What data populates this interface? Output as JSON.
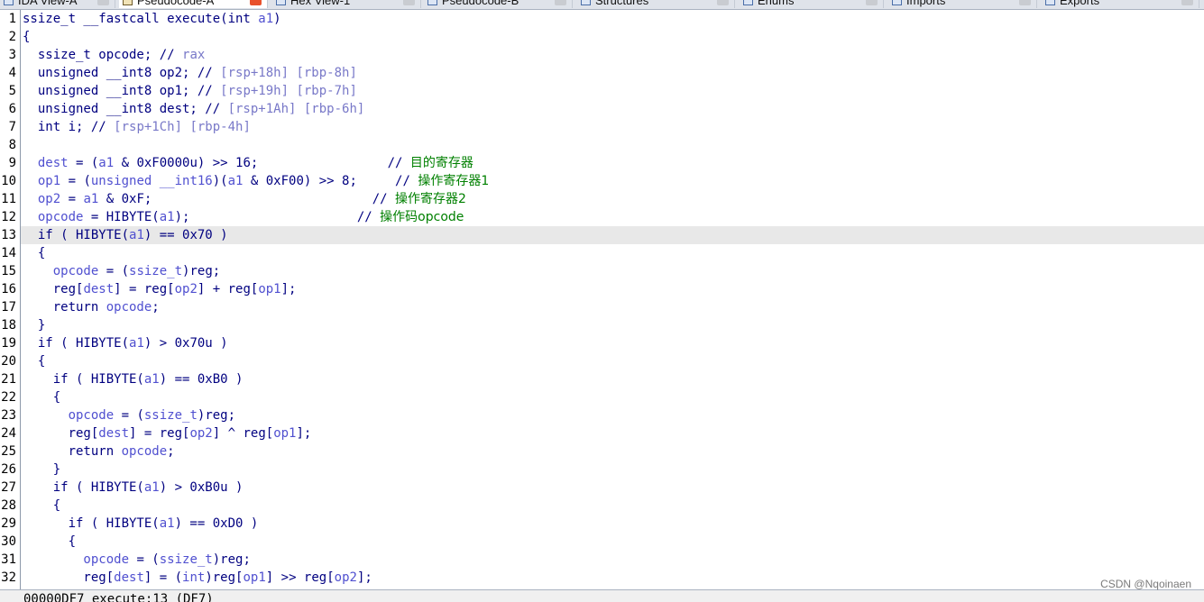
{
  "tabs": [
    {
      "label": "IDA View-A",
      "active": false
    },
    {
      "label": "Pseudocode-A",
      "active": true
    },
    {
      "label": "Hex View-1",
      "active": false
    },
    {
      "label": "Pseudocode-B",
      "active": false
    },
    {
      "label": "Structures",
      "active": false
    },
    {
      "label": "Enums",
      "active": false
    },
    {
      "label": "Imports",
      "active": false
    },
    {
      "label": "Exports",
      "active": false
    }
  ],
  "current_line": 13,
  "code_lines": [
    {
      "n": "1",
      "segs": [
        [
          "t-def",
          "ssize_t __fastcall execute(int "
        ],
        [
          "t-var",
          "a1"
        ],
        [
          "t-def",
          ")"
        ]
      ]
    },
    {
      "n": "2",
      "segs": [
        [
          "t-def",
          "{"
        ]
      ]
    },
    {
      "n": "3",
      "segs": [
        [
          "t-def",
          "  ssize_t opcode; // "
        ],
        [
          "t-cmt",
          "rax"
        ]
      ]
    },
    {
      "n": "4",
      "segs": [
        [
          "t-def",
          "  unsigned __int8 op2; // "
        ],
        [
          "t-cmt",
          "[rsp+18h] [rbp-8h]"
        ]
      ]
    },
    {
      "n": "5",
      "segs": [
        [
          "t-def",
          "  unsigned __int8 op1; // "
        ],
        [
          "t-cmt",
          "[rsp+19h] [rbp-7h]"
        ]
      ]
    },
    {
      "n": "6",
      "segs": [
        [
          "t-def",
          "  unsigned __int8 dest; // "
        ],
        [
          "t-cmt",
          "[rsp+1Ah] [rbp-6h]"
        ]
      ]
    },
    {
      "n": "7",
      "segs": [
        [
          "t-def",
          "  int i; // "
        ],
        [
          "t-cmt",
          "[rsp+1Ch] [rbp-4h]"
        ]
      ]
    },
    {
      "n": "8",
      "segs": []
    },
    {
      "n": "9",
      "segs": [
        [
          "t-var",
          "  dest"
        ],
        [
          "t-def",
          " = ("
        ],
        [
          "t-var",
          "a1"
        ],
        [
          "t-def",
          " & 0xF0000u) >> 16;                 // "
        ],
        [
          "t-cn",
          "目的寄存器"
        ]
      ]
    },
    {
      "n": "10",
      "segs": [
        [
          "t-var",
          "  op1"
        ],
        [
          "t-def",
          " = ("
        ],
        [
          "t-var",
          "unsigned __int16"
        ],
        [
          "t-def",
          ")("
        ],
        [
          "t-var",
          "a1"
        ],
        [
          "t-def",
          " & 0xF00) >> 8;     // "
        ],
        [
          "t-cn",
          "操作寄存器1"
        ]
      ]
    },
    {
      "n": "11",
      "segs": [
        [
          "t-var",
          "  op2"
        ],
        [
          "t-def",
          " = "
        ],
        [
          "t-var",
          "a1"
        ],
        [
          "t-def",
          " & 0xF;                             // "
        ],
        [
          "t-cn",
          "操作寄存器2"
        ]
      ]
    },
    {
      "n": "12",
      "segs": [
        [
          "t-var",
          "  opcode"
        ],
        [
          "t-def",
          " = HIBYTE("
        ],
        [
          "t-var",
          "a1"
        ],
        [
          "t-def",
          ");                      // "
        ],
        [
          "t-cn",
          "操作码opcode"
        ]
      ]
    },
    {
      "n": "13",
      "segs": [
        [
          "t-def",
          "  if ( HIBYTE("
        ],
        [
          "t-var",
          "a1"
        ],
        [
          "t-def",
          ") == 0x70 )"
        ]
      ]
    },
    {
      "n": "14",
      "segs": [
        [
          "t-def",
          "  {"
        ]
      ]
    },
    {
      "n": "15",
      "segs": [
        [
          "t-var",
          "    opcode"
        ],
        [
          "t-def",
          " = ("
        ],
        [
          "t-var",
          "ssize_t"
        ],
        [
          "t-def",
          ")reg;"
        ]
      ]
    },
    {
      "n": "16",
      "segs": [
        [
          "t-def",
          "    reg["
        ],
        [
          "t-var",
          "dest"
        ],
        [
          "t-def",
          "] = reg["
        ],
        [
          "t-var",
          "op2"
        ],
        [
          "t-def",
          "] + reg["
        ],
        [
          "t-var",
          "op1"
        ],
        [
          "t-def",
          "];"
        ]
      ]
    },
    {
      "n": "17",
      "segs": [
        [
          "t-def",
          "    return "
        ],
        [
          "t-var",
          "opcode"
        ],
        [
          "t-def",
          ";"
        ]
      ]
    },
    {
      "n": "18",
      "segs": [
        [
          "t-def",
          "  }"
        ]
      ]
    },
    {
      "n": "19",
      "segs": [
        [
          "t-def",
          "  if ( HIBYTE("
        ],
        [
          "t-var",
          "a1"
        ],
        [
          "t-def",
          ") > 0x70u )"
        ]
      ]
    },
    {
      "n": "20",
      "segs": [
        [
          "t-def",
          "  {"
        ]
      ]
    },
    {
      "n": "21",
      "segs": [
        [
          "t-def",
          "    if ( HIBYTE("
        ],
        [
          "t-var",
          "a1"
        ],
        [
          "t-def",
          ") == 0xB0 )"
        ]
      ]
    },
    {
      "n": "22",
      "segs": [
        [
          "t-def",
          "    {"
        ]
      ]
    },
    {
      "n": "23",
      "segs": [
        [
          "t-var",
          "      opcode"
        ],
        [
          "t-def",
          " = ("
        ],
        [
          "t-var",
          "ssize_t"
        ],
        [
          "t-def",
          ")reg;"
        ]
      ]
    },
    {
      "n": "24",
      "segs": [
        [
          "t-def",
          "      reg["
        ],
        [
          "t-var",
          "dest"
        ],
        [
          "t-def",
          "] = reg["
        ],
        [
          "t-var",
          "op2"
        ],
        [
          "t-def",
          "] ^ reg["
        ],
        [
          "t-var",
          "op1"
        ],
        [
          "t-def",
          "];"
        ]
      ]
    },
    {
      "n": "25",
      "segs": [
        [
          "t-def",
          "      return "
        ],
        [
          "t-var",
          "opcode"
        ],
        [
          "t-def",
          ";"
        ]
      ]
    },
    {
      "n": "26",
      "segs": [
        [
          "t-def",
          "    }"
        ]
      ]
    },
    {
      "n": "27",
      "segs": [
        [
          "t-def",
          "    if ( HIBYTE("
        ],
        [
          "t-var",
          "a1"
        ],
        [
          "t-def",
          ") > 0xB0u )"
        ]
      ]
    },
    {
      "n": "28",
      "segs": [
        [
          "t-def",
          "    {"
        ]
      ]
    },
    {
      "n": "29",
      "segs": [
        [
          "t-def",
          "      if ( HIBYTE("
        ],
        [
          "t-var",
          "a1"
        ],
        [
          "t-def",
          ") == 0xD0 )"
        ]
      ]
    },
    {
      "n": "30",
      "segs": [
        [
          "t-def",
          "      {"
        ]
      ]
    },
    {
      "n": "31",
      "segs": [
        [
          "t-var",
          "        opcode"
        ],
        [
          "t-def",
          " = ("
        ],
        [
          "t-var",
          "ssize_t"
        ],
        [
          "t-def",
          ")reg;"
        ]
      ]
    },
    {
      "n": "32",
      "segs": [
        [
          "t-def",
          "        reg["
        ],
        [
          "t-var",
          "dest"
        ],
        [
          "t-def",
          "] = ("
        ],
        [
          "t-var",
          "int"
        ],
        [
          "t-def",
          ")reg["
        ],
        [
          "t-var",
          "op1"
        ],
        [
          "t-def",
          "] >> reg["
        ],
        [
          "t-var",
          "op2"
        ],
        [
          "t-def",
          "];"
        ]
      ]
    }
  ],
  "status": {
    "text": "00000DF7 execute:13 (DF7)"
  },
  "watermark": "CSDN @Nqoinaen"
}
